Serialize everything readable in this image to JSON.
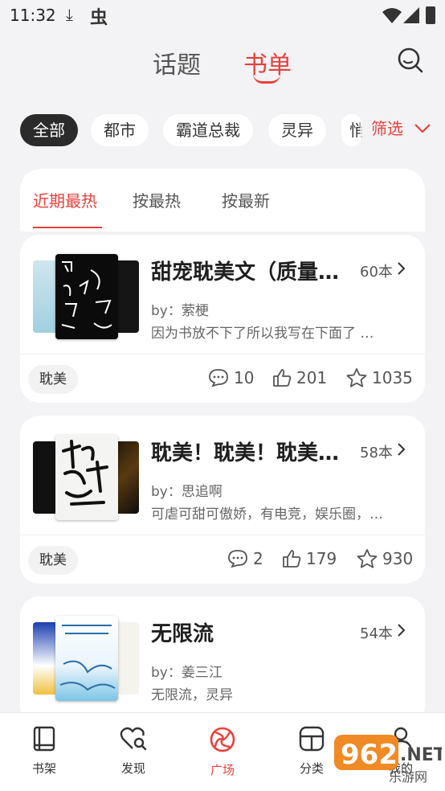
{
  "status": {
    "time": "11:32"
  },
  "nav": {
    "tab_topic": "话题",
    "tab_booklist": "书单"
  },
  "chips": [
    "全部",
    "都市",
    "霸道总裁",
    "灵异",
    "悄"
  ],
  "filter_label": "筛选",
  "sort_tabs": [
    "近期最热",
    "按最热",
    "按最新"
  ],
  "booklists": [
    {
      "title": "甜宠耽美文（质量…",
      "count": "60本",
      "author": "by：萦梗",
      "desc": "因为书放不下了所以我写在下面了 …",
      "tag": "耽美",
      "comments": "10",
      "likes": "201",
      "favorites": "1035"
    },
    {
      "title": "耽美！耽美！耽美…",
      "count": "58本",
      "author": "by：思追啊",
      "desc": "可虐可甜可傲娇，有电竞，娱乐圈，…",
      "tag": "耽美",
      "comments": "2",
      "likes": "179",
      "favorites": "930"
    },
    {
      "title": "无限流",
      "count": "54本",
      "author": "by：姜三江",
      "desc": "无限流，灵异"
    }
  ],
  "bottom_nav": [
    "书架",
    "发现",
    "广场",
    "分类",
    "我的"
  ],
  "watermark": {
    "text": "962",
    "suffix": ".NET",
    "sub": "乐游网"
  },
  "colors": {
    "accent": "#e8403b",
    "background": "#f3f3f5",
    "chip_active": "#2b2b2b"
  }
}
